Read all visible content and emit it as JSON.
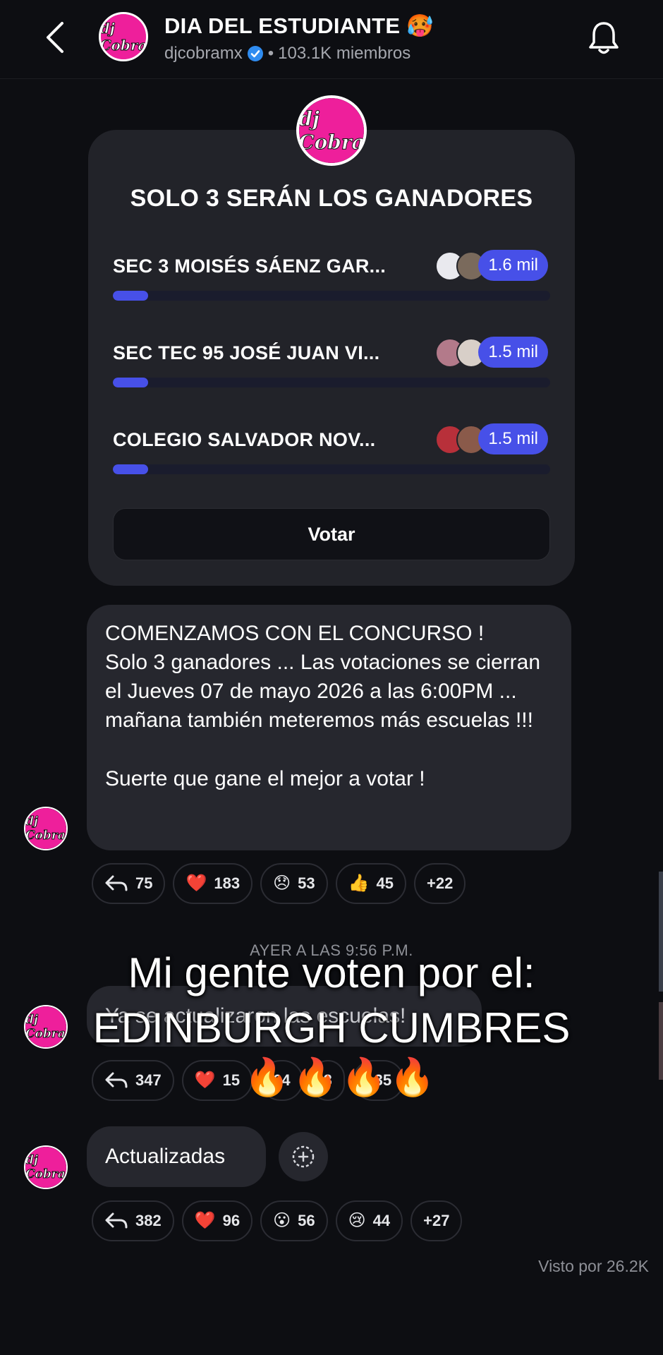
{
  "header": {
    "title": "DIA DEL ESTUDIANTE 🥵",
    "channel_handle": "djcobramx",
    "separator": "•",
    "members": "103.1K miembros",
    "avatar_text": "dj Cobra"
  },
  "poll": {
    "question": "SOLO 3 SERÁN LOS GANADORES",
    "options": [
      {
        "label": "SEC 3 MOISÉS SÁENZ GAR...",
        "votes": "1.6 mil",
        "progress": 0.08
      },
      {
        "label": "SEC TEC 95 JOSÉ JUAN VI...",
        "votes": "1.5 mil",
        "progress": 0.08
      },
      {
        "label": "COLEGIO SALVADOR NOV...",
        "votes": "1.5 mil",
        "progress": 0.08
      }
    ],
    "vote_button": "Votar",
    "accent_color": "#4750e8"
  },
  "messages": [
    {
      "lines": [
        "COMENZAMOS CON EL CONCURSO !",
        "Solo 3 ganadores ... Las votaciones se cierran el Jueves 07 de mayo 2026 a las 6:00PM ... mañana también meteremos más escuelas !!!"
      ],
      "closing": "Suerte que gane el mejor a votar !",
      "reactions": [
        {
          "icon": "reply-icon",
          "emoji": "",
          "count": "75"
        },
        {
          "icon": "heart",
          "emoji": "❤️",
          "count": "183"
        },
        {
          "icon": "disappointed",
          "emoji": "😞",
          "count": "53"
        },
        {
          "icon": "thumbs-up",
          "emoji": "👍",
          "count": "45"
        },
        {
          "icon": "more",
          "emoji": "",
          "count": "+22"
        }
      ]
    },
    {
      "text": "Ya se actualizaron las escuelas!",
      "reactions": [
        {
          "icon": "reply-icon",
          "emoji": "",
          "count": "347"
        },
        {
          "icon": "heart",
          "emoji": "❤️",
          "count": "15"
        },
        {
          "icon": "hidden",
          "emoji": "",
          "count": "64"
        },
        {
          "icon": "hidden",
          "emoji": "",
          "count": "3"
        },
        {
          "icon": "more",
          "emoji": "",
          "count": "+35"
        }
      ]
    },
    {
      "text": "Actualizadas",
      "reactions": [
        {
          "icon": "reply-icon",
          "emoji": "",
          "count": "382"
        },
        {
          "icon": "heart",
          "emoji": "❤️",
          "count": "96"
        },
        {
          "icon": "hushed",
          "emoji": "😮",
          "count": "56"
        },
        {
          "icon": "crying",
          "emoji": "😢",
          "count": "44"
        },
        {
          "icon": "more",
          "emoji": "",
          "count": "+27"
        }
      ]
    }
  ],
  "timestamp": "AYER A LAS 9:56 P.M.",
  "seen_by": "Visto por 26.2K",
  "overlay": {
    "line1": "Mi gente voten por el:",
    "line2": "EDINBURGH CUMBRES",
    "fires": "🔥🔥🔥🔥"
  }
}
